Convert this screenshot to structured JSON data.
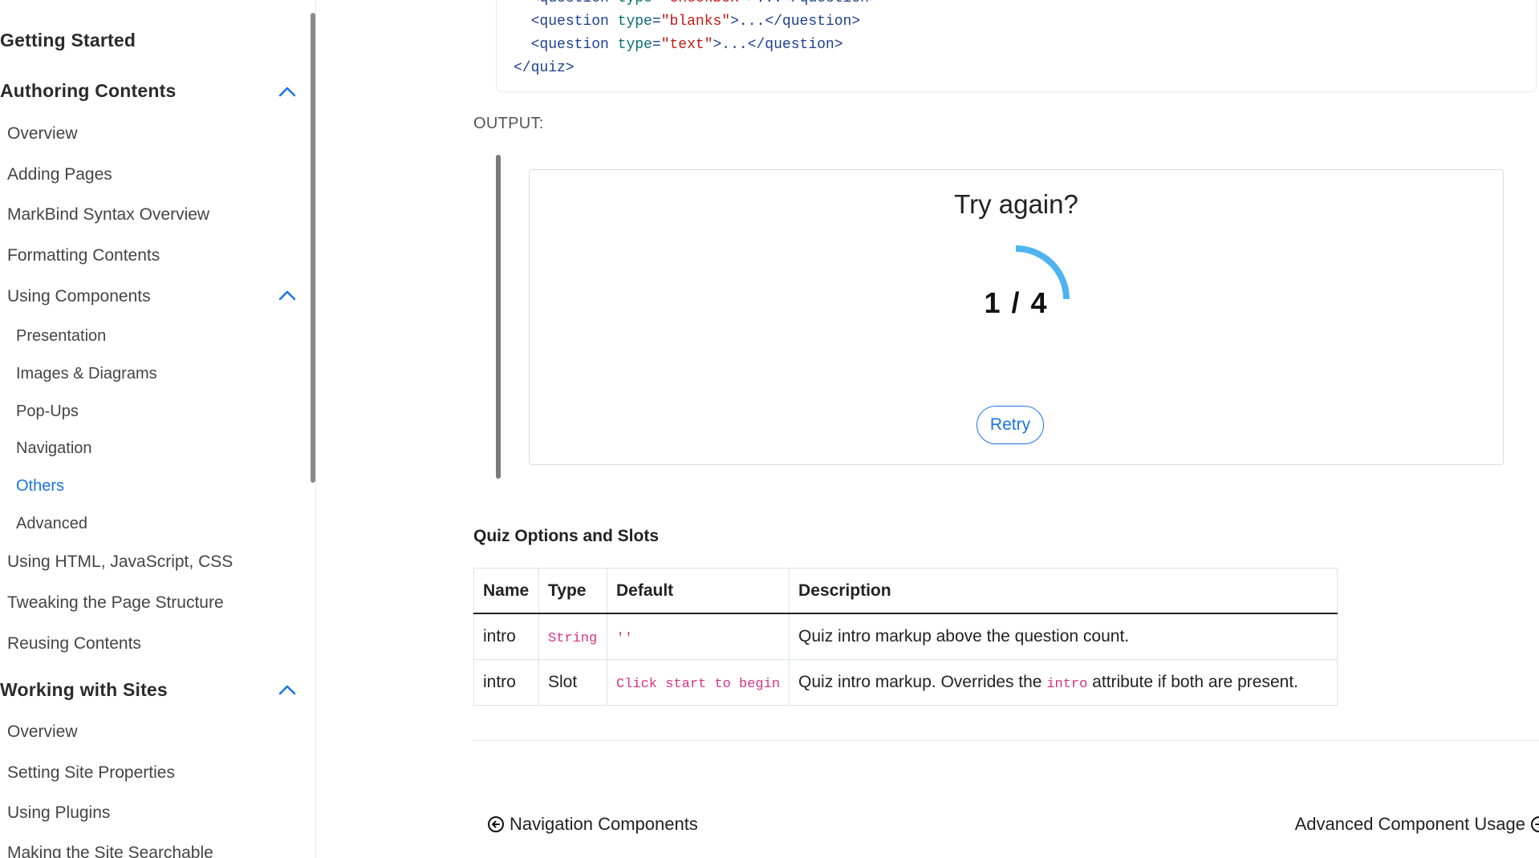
{
  "sidebar": {
    "sections": [
      {
        "label": "Getting Started"
      },
      {
        "label": "Authoring Contents"
      },
      {
        "label": "Working with Sites"
      }
    ],
    "authoring_items": [
      "Overview",
      "Adding Pages",
      "MarkBind Syntax Overview",
      "Formatting Contents",
      "Using Components",
      "Using HTML, JavaScript, CSS",
      "Tweaking the Page Structure",
      "Reusing Contents"
    ],
    "component_items": [
      "Presentation",
      "Images & Diagrams",
      "Pop-Ups",
      "Navigation",
      "Others",
      "Advanced"
    ],
    "sites_items": [
      "Overview",
      "Setting Site Properties",
      "Using Plugins",
      "Making the Site Searchable"
    ],
    "active_item": "Others",
    "accent_color": "#1a73e8"
  },
  "code": {
    "lines": [
      {
        "indent": "  ",
        "tag": "question",
        "attr": "type",
        "value": "\"checkbox\"",
        "rest": ">...</question>"
      },
      {
        "indent": "  ",
        "tag": "question",
        "attr": "type",
        "value": "\"blanks\"",
        "rest": ">...</question>"
      },
      {
        "indent": "  ",
        "tag": "question",
        "attr": "type",
        "value": "\"text\"",
        "rest": ">...</question>"
      }
    ],
    "closing": "</quiz>"
  },
  "output": {
    "label": "OUTPUT:",
    "quiz": {
      "title": "Try again?",
      "score": "1 / 4",
      "correct": 1,
      "total": 4,
      "progress_color": "#4fb3f0",
      "retry_label": "Retry"
    }
  },
  "options": {
    "heading": "Quiz Options and Slots",
    "columns": [
      "Name",
      "Type",
      "Default",
      "Description"
    ],
    "rows": [
      {
        "name": "intro",
        "type": "String",
        "type_is_code": true,
        "default": "''",
        "desc_before": "Quiz intro markup above the question count.",
        "desc_code": "",
        "desc_after": ""
      },
      {
        "name": "intro",
        "type": "Slot",
        "type_is_code": false,
        "default": "Click start to begin",
        "desc_before": "Quiz intro markup. Overrides the ",
        "desc_code": "intro",
        "desc_after": " attribute if both are present."
      }
    ]
  },
  "footer_nav": {
    "prev_label": "Navigation Components",
    "next_label": "Advanced Component Usage"
  }
}
